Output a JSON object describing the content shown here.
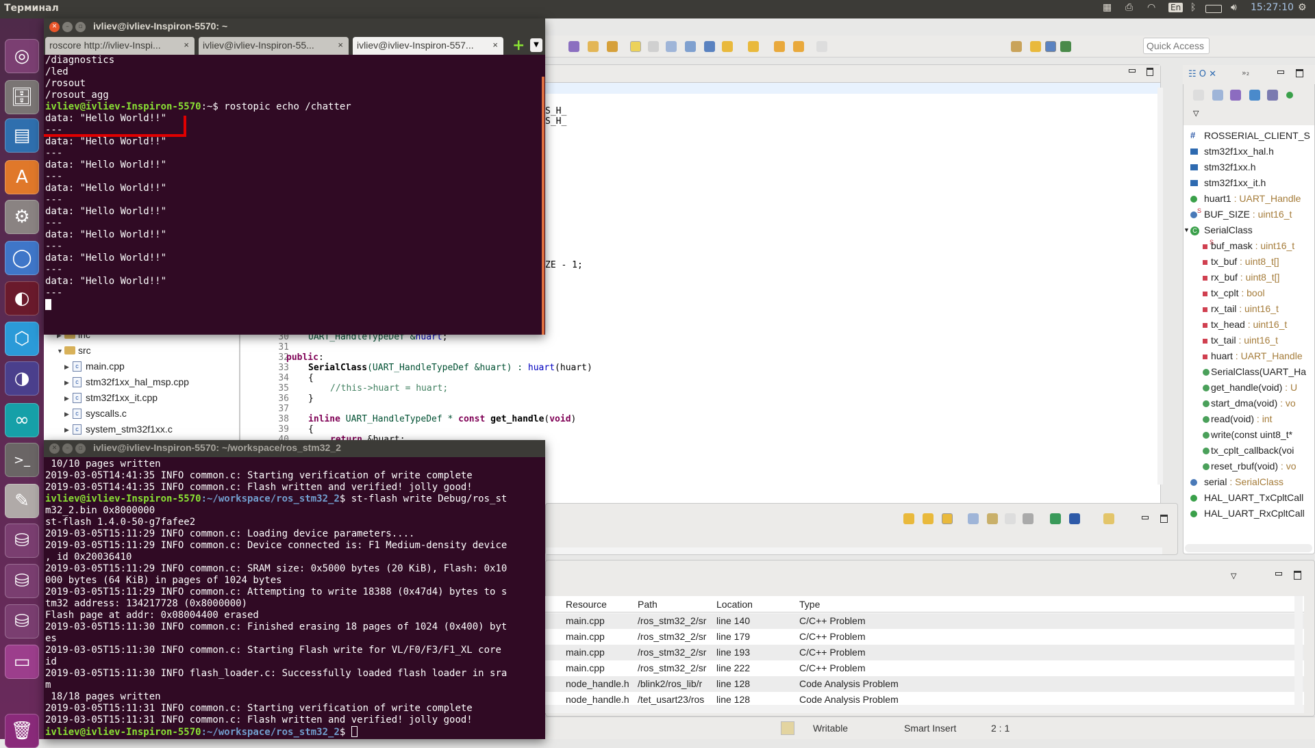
{
  "topbar": {
    "app_title": "Терминал",
    "keyboard_layout": "En",
    "clock": "15:27:10"
  },
  "launcher": {
    "items": [
      "ubuntu-dash",
      "files",
      "libreoffice-impress",
      "software-center",
      "system-settings",
      "chromium",
      "eclipse-dark",
      "virtualbox",
      "eclipse",
      "arduino",
      "terminal",
      "text-editor",
      "drive-1",
      "drive-2",
      "drive-3",
      "workspace-switcher",
      "trash"
    ]
  },
  "terminal1": {
    "title": "ivliev@ivliev-Inspiron-5570: ~",
    "tabs": [
      {
        "label": "roscore http://ivliev-Inspi..."
      },
      {
        "label": "ivliev@ivliev-Inspiron-55..."
      },
      {
        "label": "ivliev@ivliev-Inspiron-557..."
      }
    ],
    "lines_before": [
      "/diagnostics",
      "/led",
      "/rosout",
      "/rosout_agg"
    ],
    "prompt_user": "ivliev@ivliev-Inspiron-5570",
    "prompt_path": ":~$ ",
    "command": "rostopic echo /chatter",
    "output": [
      "data: \"Hello World!!\"",
      "---",
      "data: \"Hello World!!\"",
      "---",
      "data: \"Hello World!!\"",
      "---",
      "data: \"Hello World!!\"",
      "---",
      "data: \"Hello World!!\"",
      "---",
      "data: \"Hello World!!\"",
      "---",
      "data: \"Hello World!!\"",
      "---",
      "data: \"Hello World!!\"",
      "---"
    ],
    "annotation_color": "#e00000"
  },
  "terminal2": {
    "title": "ivliev@ivliev-Inspiron-5570: ~/workspace/ros_stm32_2",
    "prompt_user": "ivliev@ivliev-Inspiron-5570",
    "prompt_path": ":~/workspace/ros_stm32_2",
    "lines": [
      " 10/10 pages written",
      "2019-03-05T14:41:35 INFO common.c: Starting verification of write complete",
      "2019-03-05T14:41:35 INFO common.c: Flash written and verified! jolly good!",
      "$PROMPT$ st-flash write Debug/ros_st",
      "m32_2.bin 0x8000000",
      "st-flash 1.4.0-50-g7fafee2",
      "2019-03-05T15:11:29 INFO common.c: Loading device parameters....",
      "2019-03-05T15:11:29 INFO common.c: Device connected is: F1 Medium-density device",
      ", id 0x20036410",
      "2019-03-05T15:11:29 INFO common.c: SRAM size: 0x5000 bytes (20 KiB), Flash: 0x10",
      "000 bytes (64 KiB) in pages of 1024 bytes",
      "2019-03-05T15:11:29 INFO common.c: Attempting to write 18388 (0x47d4) bytes to s",
      "tm32 address: 134217728 (0x8000000)",
      "Flash page at addr: 0x08004400 erased",
      "2019-03-05T15:11:30 INFO common.c: Finished erasing 18 pages of 1024 (0x400) byt",
      "es",
      "2019-03-05T15:11:30 INFO common.c: Starting Flash write for VL/F0/F3/F1_XL core",
      "id",
      "2019-03-05T15:11:30 INFO flash_loader.c: Successfully loaded flash loader in sra",
      "m",
      " 18/18 pages written",
      "2019-03-05T15:11:31 INFO common.c: Starting verification of write complete",
      "2019-03-05T15:11:31 INFO common.c: Flash written and verified! jolly good!",
      "$PROMPT$ "
    ]
  },
  "eclipse": {
    "quick_access_placeholder": "Quick Access",
    "editor_fragments": [
      "S_H_",
      "S_H_",
      "ZE - 1;"
    ],
    "code": {
      "line_numbers": [
        "30",
        "31",
        "32",
        "33",
        "34",
        "35",
        "36",
        "37",
        "38",
        "39",
        "40"
      ],
      "l30": [
        "UART_HandleTypeDef &",
        "huart",
        ";"
      ],
      "l32": "public",
      "l33": [
        "SerialClass",
        "(UART_HandleTypeDef &huart) : ",
        "huart",
        "(huart)"
      ],
      "l34": "{",
      "l35": "//this->huart = huart;",
      "l36": "}",
      "l38": [
        "inline",
        " UART_HandleTypeDef * ",
        "const",
        " get_handle",
        "(",
        "void",
        ")"
      ],
      "l39": "{",
      "l40": [
        "return",
        " &huart;"
      ]
    },
    "explorer": {
      "items": [
        {
          "label": "inc",
          "level": 1
        },
        {
          "label": "src",
          "level": 1,
          "expanded": true
        },
        {
          "label": "main.cpp",
          "level": 2,
          "warning": true
        },
        {
          "label": "stm32f1xx_hal_msp.cpp",
          "level": 2,
          "warning": true
        },
        {
          "label": "stm32f1xx_it.cpp",
          "level": 2
        },
        {
          "label": "syscalls.c",
          "level": 2
        },
        {
          "label": "system_stm32f1xx.c",
          "level": 2
        }
      ]
    },
    "outline": {
      "items": [
        {
          "name": "ROSSERIAL_CLIENT_S",
          "type": "",
          "kind": "macro",
          "level": 0
        },
        {
          "name": "stm32f1xx_hal.h",
          "type": "",
          "kind": "include",
          "level": 0
        },
        {
          "name": "stm32f1xx.h",
          "type": "",
          "kind": "include",
          "level": 0
        },
        {
          "name": "stm32f1xx_it.h",
          "type": "",
          "kind": "include",
          "level": 0
        },
        {
          "name": "huart1",
          "type": " : UART_Handle",
          "kind": "var",
          "level": 0
        },
        {
          "name": "BUF_SIZE",
          "type": " : uint16_t",
          "kind": "static-var",
          "level": 0
        },
        {
          "name": "SerialClass",
          "type": "",
          "kind": "class",
          "level": 0
        },
        {
          "name": "buf_mask",
          "type": " : uint16_t",
          "kind": "private-static",
          "level": 1
        },
        {
          "name": "tx_buf",
          "type": " : uint8_t[]",
          "kind": "private",
          "level": 1
        },
        {
          "name": "rx_buf",
          "type": " : uint8_t[]",
          "kind": "private",
          "level": 1
        },
        {
          "name": "tx_cplt",
          "type": " : bool",
          "kind": "private",
          "level": 1
        },
        {
          "name": "rx_tail",
          "type": " : uint16_t",
          "kind": "private",
          "level": 1
        },
        {
          "name": "tx_head",
          "type": " : uint16_t",
          "kind": "private",
          "level": 1
        },
        {
          "name": "tx_tail",
          "type": " : uint16_t",
          "kind": "private",
          "level": 1
        },
        {
          "name": "huart",
          "type": " : UART_Handle",
          "kind": "private",
          "level": 1
        },
        {
          "name": "SerialClass(UART_Ha",
          "type": "",
          "kind": "method",
          "level": 1
        },
        {
          "name": "get_handle(void)",
          "type": " : U",
          "kind": "method",
          "level": 1
        },
        {
          "name": "start_dma(void)",
          "type": " : vo",
          "kind": "method",
          "level": 1
        },
        {
          "name": "read(void)",
          "type": " : int",
          "kind": "method",
          "level": 1
        },
        {
          "name": "write(const uint8_t*",
          "type": "",
          "kind": "method",
          "level": 1
        },
        {
          "name": "tx_cplt_callback(voi",
          "type": "",
          "kind": "method",
          "level": 1
        },
        {
          "name": "reset_rbuf(void)",
          "type": " : vo",
          "kind": "method",
          "level": 1
        },
        {
          "name": "serial",
          "type": " : SerialClass",
          "kind": "var-blue",
          "level": 0
        },
        {
          "name": "HAL_UART_TxCpltCall",
          "type": "",
          "kind": "function",
          "level": 0
        },
        {
          "name": "HAL_UART_RxCpltCall",
          "type": "",
          "kind": "function",
          "level": 0
        }
      ]
    },
    "problems": {
      "columns": [
        "Resource",
        "Path",
        "Location",
        "Type"
      ],
      "rows": [
        [
          "main.cpp",
          "/ros_stm32_2/sr",
          "line 140",
          "C/C++ Problem"
        ],
        [
          "main.cpp",
          "/ros_stm32_2/sr",
          "line 179",
          "C/C++ Problem"
        ],
        [
          "main.cpp",
          "/ros_stm32_2/sr",
          "line 193",
          "C/C++ Problem"
        ],
        [
          "main.cpp",
          "/ros_stm32_2/sr",
          "line 222",
          "C/C++ Problem"
        ],
        [
          "node_handle.h",
          "/blink2/ros_lib/r",
          "line 128",
          "Code Analysis Problem"
        ],
        [
          "node_handle.h",
          "/tet_usart23/ros",
          "line 128",
          "Code Analysis Problem"
        ]
      ]
    },
    "statusbar": {
      "writable": "Writable",
      "insert_mode": "Smart Insert",
      "position": "2 : 1"
    }
  }
}
